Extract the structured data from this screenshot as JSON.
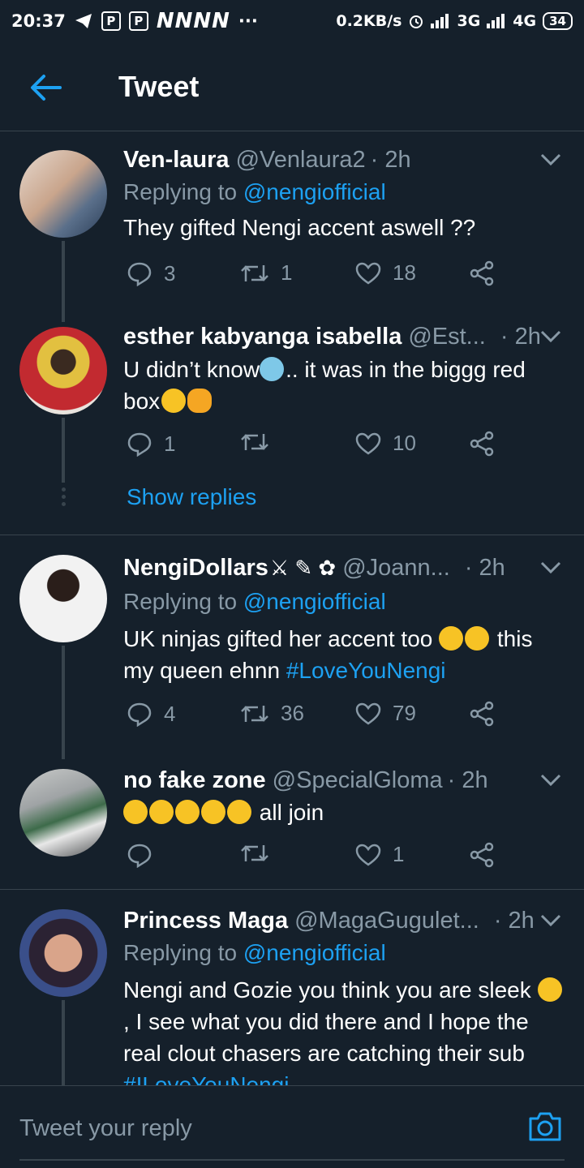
{
  "status": {
    "time": "20:37",
    "letters": "NNNN",
    "ellipsis": "···",
    "speed": "0.2KB/s",
    "net1": "3G",
    "net2": "4G",
    "battery": "34"
  },
  "header": {
    "title": "Tweet"
  },
  "tweets": [
    {
      "name": "Ven-laura",
      "handle": "@Venlaura2",
      "time": "· 2h",
      "replying_label": "Replying to",
      "replying_to": "@nengiofficial",
      "text": "They gifted Nengi accent aswell ??",
      "replies": "3",
      "retweets": "1",
      "likes": "18"
    },
    {
      "name": "esther kabyanga isabella",
      "handle": "@Est...",
      "time": "· 2h",
      "text_a": "U didn’t know",
      "text_b": ".. it was in the biggg red box",
      "replies": "1",
      "retweets": "",
      "likes": "10",
      "show_replies": "Show replies"
    },
    {
      "name": "NengiDollars",
      "handle": "@Joann...",
      "time": "· 2h",
      "replying_label": "Replying to",
      "replying_to": "@nengiofficial",
      "text_a": "UK ninjas gifted her accent too",
      "text_b": "this my queen ehnn",
      "hashtag": "#LoveYouNengi",
      "replies": "4",
      "retweets": "36",
      "likes": "79"
    },
    {
      "name": "no fake zone",
      "handle": "@SpecialGloma",
      "time": "· 2h",
      "text": "all join",
      "replies": "",
      "retweets": "",
      "likes": "1"
    },
    {
      "name": "Princess Maga",
      "handle": "@MagaGugulet...",
      "time": "· 2h",
      "replying_label": "Replying to",
      "replying_to": "@nengiofficial",
      "text_a": "Nengi and Gozie you think you are sleek",
      "text_b": ",  I see what you did there and I hope the real clout chasers are catching their sub",
      "hashtag": "#ILoveYouNengi"
    }
  ],
  "reply_bar": {
    "placeholder": "Tweet your reply"
  },
  "colors": {
    "background": "#15202b",
    "accent": "#1da1f2",
    "muted": "#8899a6",
    "divider": "#38444d"
  }
}
